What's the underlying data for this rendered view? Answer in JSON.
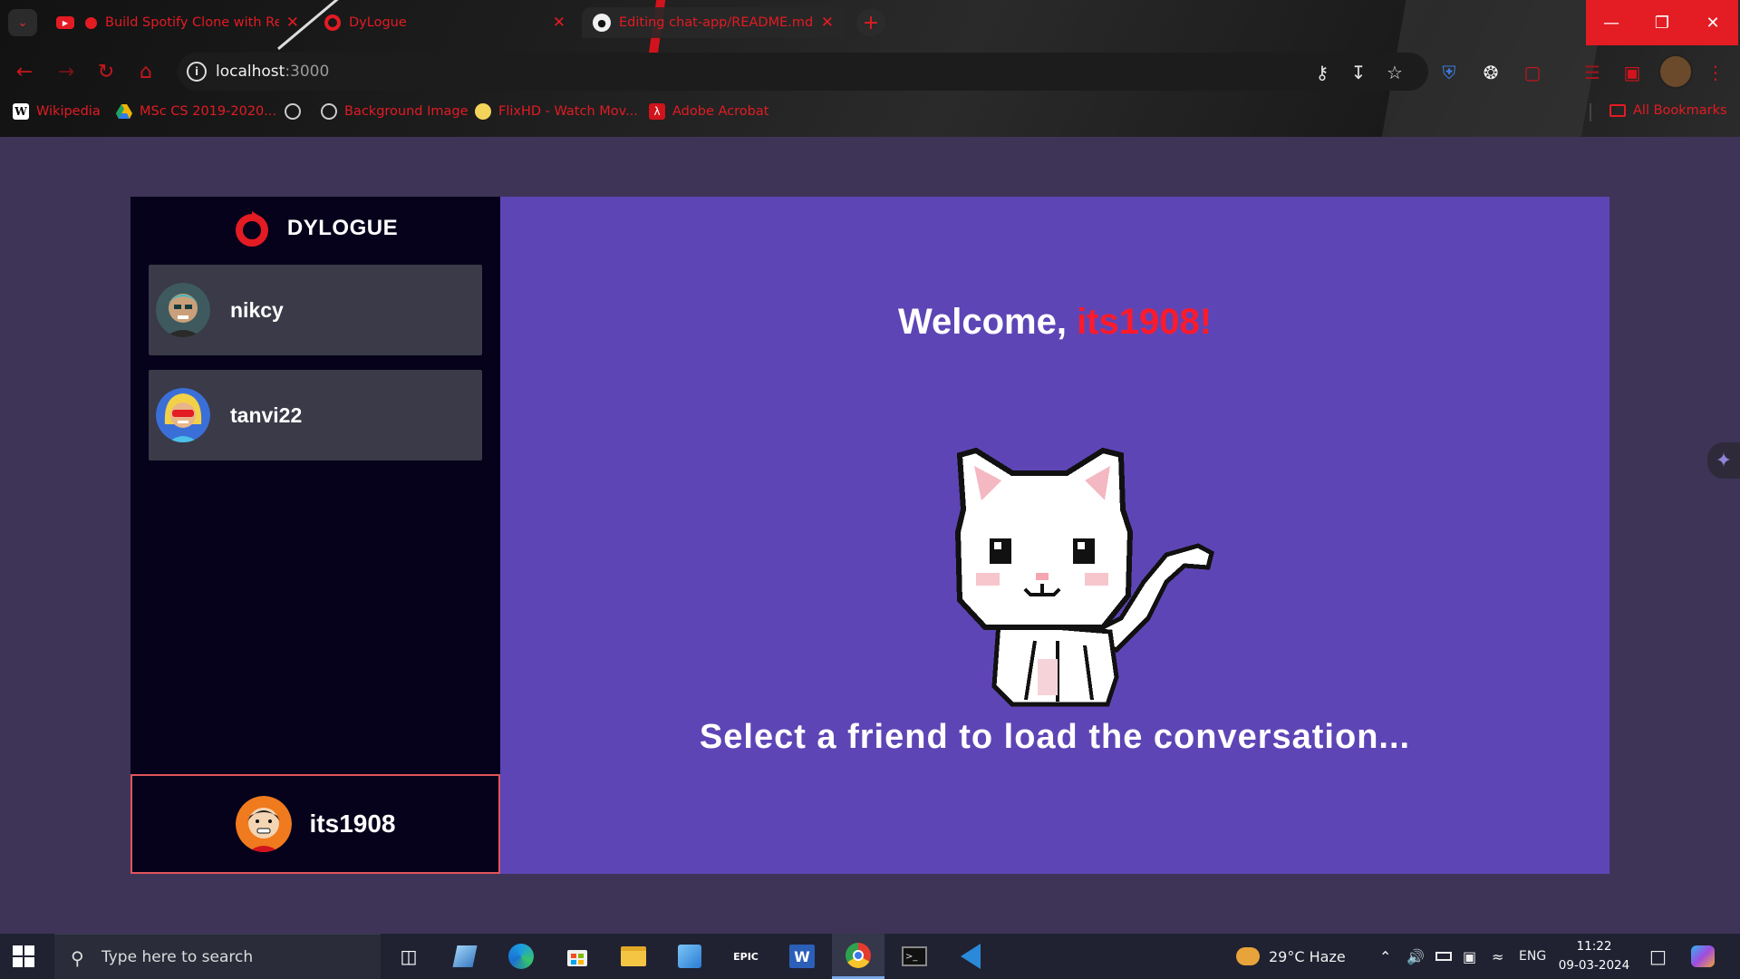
{
  "browser": {
    "tabs": [
      {
        "title": "Build Spotify Clone with Re",
        "icon": "youtube-icon"
      },
      {
        "title": "DyLogue",
        "icon": "dylogue-icon"
      },
      {
        "title": "Editing chat-app/README.md",
        "icon": "github-icon"
      }
    ],
    "url_host": "localhost",
    "url_port": ":3000",
    "bookmarks": [
      {
        "label": "Wikipedia",
        "icon": "wikipedia-icon"
      },
      {
        "label": "MSc CS 2019-2020...",
        "icon": "drive-icon"
      },
      {
        "label": "",
        "icon": "globe-icon"
      },
      {
        "label": "Background Image",
        "icon": "globe-icon"
      },
      {
        "label": "FlixHD - Watch Mov...",
        "icon": "flixhd-icon"
      },
      {
        "label": "Adobe Acrobat",
        "icon": "acrobat-icon"
      }
    ],
    "all_bookmarks": "All Bookmarks",
    "accent": "#e31b23"
  },
  "app": {
    "brand": "DYLOGUE",
    "contacts": [
      {
        "name": "nikcy"
      },
      {
        "name": "tanvi22"
      }
    ],
    "current_user": "its1908",
    "welcome_prefix": "Welcome, ",
    "welcome_user": "its1908!",
    "select_message": "Select a friend to load the conversation...",
    "colors": {
      "sidebar": "#07021b",
      "main": "#5e45b5",
      "highlight": "#ff1a2b"
    }
  },
  "taskbar": {
    "search_placeholder": "Type here to search",
    "weather": "29°C  Haze",
    "language": "ENG",
    "time": "11:22",
    "date": "09-03-2024"
  }
}
